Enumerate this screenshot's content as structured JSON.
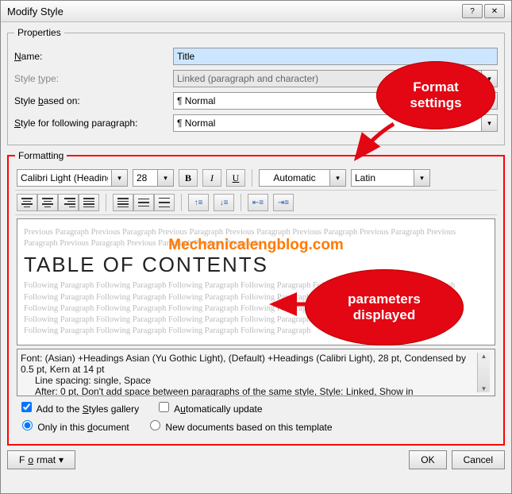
{
  "window": {
    "title": "Modify Style"
  },
  "properties": {
    "legend": "Properties",
    "name_label": "Name:",
    "name_value": "Title",
    "type_label": "Style type:",
    "type_value": "Linked (paragraph and character)",
    "based_label": "Style based on:",
    "based_value": "¶ Normal",
    "following_label": "Style for following paragraph:",
    "following_value": "¶ Normal"
  },
  "formatting": {
    "legend": "Formatting",
    "font_name": "Calibri Light (Headings)",
    "font_size": "28",
    "bold": "B",
    "italic": "I",
    "underline": "U",
    "font_color": "Automatic",
    "script": "Latin"
  },
  "preview": {
    "prev_para": "Previous Paragraph Previous Paragraph Previous Paragraph Previous Paragraph Previous Paragraph Previous Paragraph Previous Paragraph Previous Paragraph Previous Paragraph Previous Paragraph",
    "sample": "TABLE OF CONTENTS",
    "follow_para": "Following Paragraph Following Paragraph Following Paragraph Following Paragraph Following Paragraph Following Paragraph Following Paragraph Following Paragraph Following Paragraph Following Paragraph Following Paragraph Following Paragraph Following Paragraph Following Paragraph Following Paragraph Following Paragraph Following Paragraph Following Paragraph Following Paragraph Following Paragraph Following Paragraph Following Paragraph Following Paragraph Following Paragraph Following Paragraph Following Paragraph Following Paragraph Following Paragraph"
  },
  "watermark": "Mechanicalengblog.com",
  "description": {
    "line1": "Font: (Asian) +Headings Asian (Yu Gothic Light), (Default) +Headings (Calibri Light), 28 pt, Condensed by  0.5 pt, Kern at 14 pt",
    "line2": "Line spacing:  single, Space",
    "line3": "After:  0 pt, Don't add space between paragraphs of the same style, Style: Linked, Show in"
  },
  "options": {
    "add_gallery": "Add to the Styles gallery",
    "auto_update": "Automatically update",
    "only_doc": "Only in this document",
    "new_docs": "New documents based on this template"
  },
  "buttons": {
    "format": "Format",
    "ok": "OK",
    "cancel": "Cancel"
  },
  "annotations": {
    "a1_line1": "Format",
    "a1_line2": "settings",
    "a2_line1": "parameters",
    "a2_line2": "displayed"
  }
}
